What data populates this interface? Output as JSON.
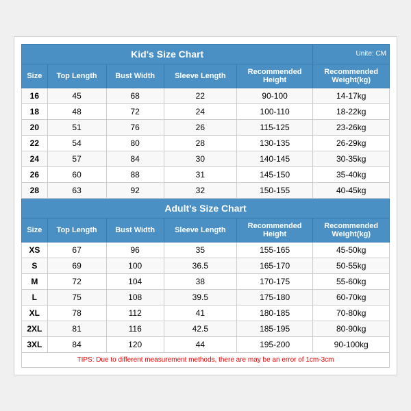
{
  "kids": {
    "title": "Kid's Size Chart",
    "unit": "Unite: CM",
    "headers": [
      "Size",
      "Top Length",
      "Bust Width",
      "Sleeve Length",
      "Recommended\nHeight",
      "Recommended\nWeight(kg)"
    ],
    "rows": [
      [
        "16",
        "45",
        "68",
        "22",
        "90-100",
        "14-17kg"
      ],
      [
        "18",
        "48",
        "72",
        "24",
        "100-110",
        "18-22kg"
      ],
      [
        "20",
        "51",
        "76",
        "26",
        "115-125",
        "23-26kg"
      ],
      [
        "22",
        "54",
        "80",
        "28",
        "130-135",
        "26-29kg"
      ],
      [
        "24",
        "57",
        "84",
        "30",
        "140-145",
        "30-35kg"
      ],
      [
        "26",
        "60",
        "88",
        "31",
        "145-150",
        "35-40kg"
      ],
      [
        "28",
        "63",
        "92",
        "32",
        "150-155",
        "40-45kg"
      ]
    ]
  },
  "adults": {
    "title": "Adult's Size Chart",
    "headers": [
      "Size",
      "Top Length",
      "Bust Width",
      "Sleeve Length",
      "Recommended\nHeight",
      "Recommended\nWeight(kg)"
    ],
    "rows": [
      [
        "XS",
        "67",
        "96",
        "35",
        "155-165",
        "45-50kg"
      ],
      [
        "S",
        "69",
        "100",
        "36.5",
        "165-170",
        "50-55kg"
      ],
      [
        "M",
        "72",
        "104",
        "38",
        "170-175",
        "55-60kg"
      ],
      [
        "L",
        "75",
        "108",
        "39.5",
        "175-180",
        "60-70kg"
      ],
      [
        "XL",
        "78",
        "112",
        "41",
        "180-185",
        "70-80kg"
      ],
      [
        "2XL",
        "81",
        "116",
        "42.5",
        "185-195",
        "80-90kg"
      ],
      [
        "3XL",
        "84",
        "120",
        "44",
        "195-200",
        "90-100kg"
      ]
    ]
  },
  "tips": "TIPS: Due to different measurement methods, there are may be an error of 1cm-3cm"
}
